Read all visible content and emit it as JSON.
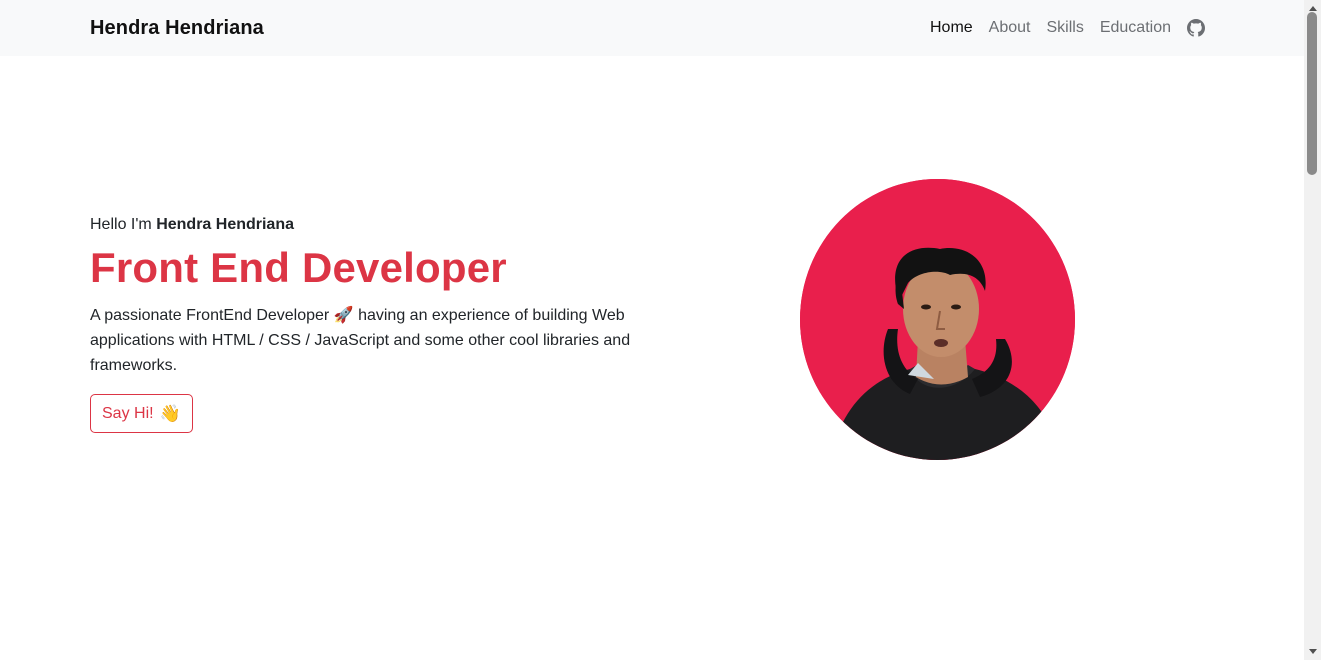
{
  "navbar": {
    "brand": "Hendra Hendriana",
    "links": [
      {
        "label": "Home"
      },
      {
        "label": "About"
      },
      {
        "label": "Skills"
      },
      {
        "label": "Education"
      }
    ],
    "github_icon": "github-icon"
  },
  "hero": {
    "greeting_prefix": "Hello I'm ",
    "greeting_name": "Hendra Hendriana",
    "headline": "Front End Developer",
    "desc_part1": "A passionate FrontEnd Developer ",
    "desc_emoji": "🚀",
    "desc_part2": " having an experience of building Web applications with HTML / CSS / JavaScript and some other cool libraries and frameworks.",
    "button_label": "Say Hi!",
    "button_emoji": "👋"
  },
  "colors": {
    "accent": "#dc3545",
    "navbar_bg": "#f8f9fa",
    "avatar_bg": "#e91f4c"
  }
}
